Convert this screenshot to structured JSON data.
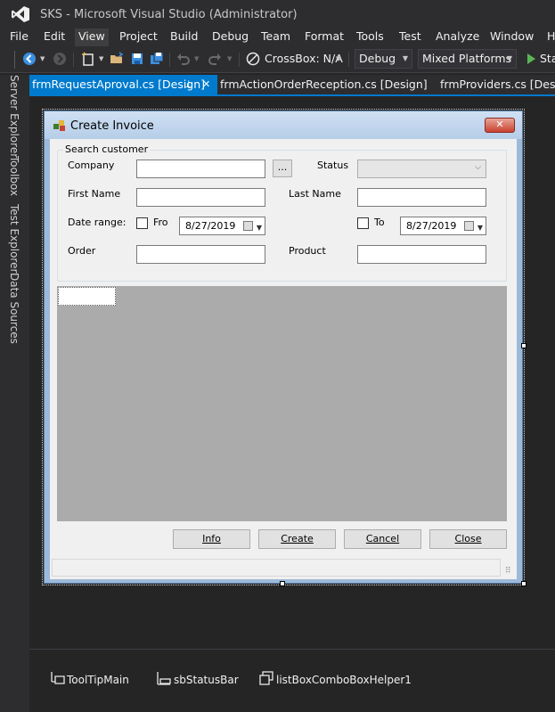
{
  "window": {
    "title": "SKS - Microsoft Visual Studio  (Administrator)"
  },
  "menu": {
    "items": [
      "File",
      "Edit",
      "View",
      "Project",
      "Build",
      "Debug",
      "Team",
      "Format",
      "Tools",
      "Test",
      "Analyze",
      "Window",
      "H"
    ],
    "active": "View"
  },
  "toolbar": {
    "crossbox_label": "CrossBox: N/A",
    "config_value": "Debug",
    "platform_value": "Mixed Platforms",
    "start_label": "Sta"
  },
  "side_tabs": [
    "Server Explorer",
    "Toolbox",
    "Test Explorer",
    "Data Sources"
  ],
  "doc_tabs": {
    "active": "frmRequestAproval.cs [Design]",
    "pin_glyph": "⊥",
    "close_glyph": "✕",
    "others": [
      "frmActionOrderReception.cs [Design]",
      "frmProviders.cs [Design]"
    ]
  },
  "form": {
    "title": "Create Invoice",
    "close_glyph": "✕",
    "group_title": "Search customer",
    "labels": {
      "company": "Company",
      "status": "Status",
      "first_name": "First Name",
      "last_name": "Last Name",
      "date_range": "Date range:",
      "from": "Fro",
      "to": "To",
      "order": "Order",
      "product": "Product"
    },
    "ellipsis_button": "...",
    "date_from": "8/27/2019",
    "date_to": "8/27/2019",
    "buttons": {
      "info": "Info",
      "create": "Create",
      "cancel": "Cancel",
      "close": "Close"
    },
    "grip_glyph": "⠿"
  },
  "tray": {
    "items": [
      "ToolTipMain",
      "sbStatusBar",
      "listBoxComboBoxHelper1"
    ]
  },
  "colors": {
    "accent": "#007acc",
    "background": "#252526",
    "chrome": "#2d2d30"
  }
}
